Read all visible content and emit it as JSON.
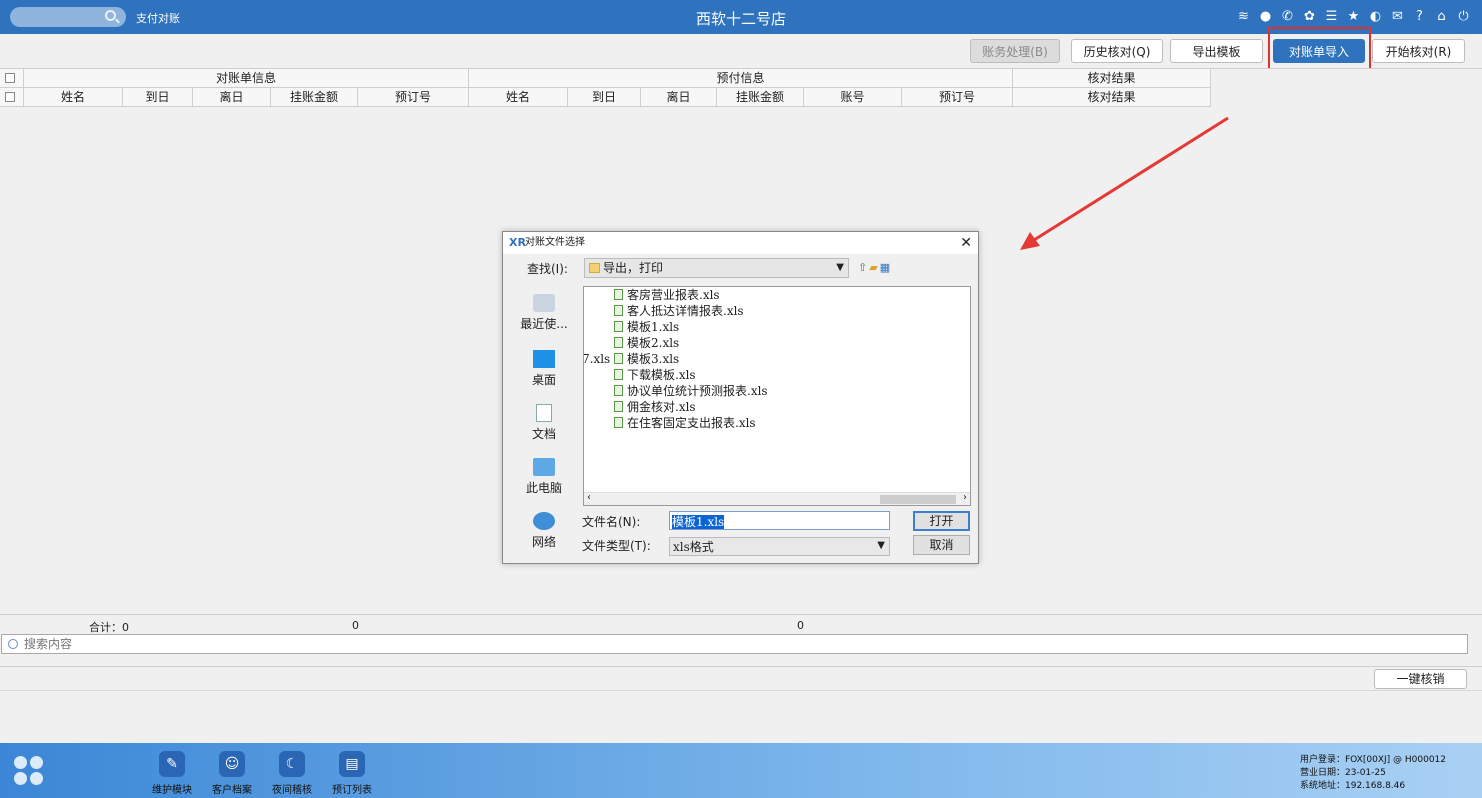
{
  "window": {
    "title": "西软十二号店",
    "module": "支付对账"
  },
  "toolbar": {
    "btn_accounting": "账务处理(B)",
    "btn_history": "历史核对(Q)",
    "btn_export_template": "导出模板",
    "btn_import": "对账单导入",
    "btn_start": "开始核对(R)"
  },
  "grid": {
    "group_headers": [
      "对账单信息",
      "预付信息",
      "核对结果"
    ],
    "columns": [
      "姓名",
      "到日",
      "离日",
      "挂账金额",
      "预订号",
      "姓名",
      "到日",
      "离日",
      "挂账金额",
      "账号",
      "预订号",
      "核对结果"
    ]
  },
  "summary": {
    "label": "合计：0",
    "value1": "0",
    "value2": "0"
  },
  "search": {
    "placeholder": "搜索内容"
  },
  "actions": {
    "one_click": "一键核销"
  },
  "dock": [
    "维护模块",
    "客户档案",
    "夜间稽核",
    "预订列表"
  ],
  "sysinfo": {
    "user": "用户登录：FOX[00XJ] @ H000012",
    "date": "营业日期：23-01-25",
    "addr": "系统地址：192.168.8.46"
  },
  "dialog": {
    "title": "对账文件选择",
    "lookin_label": "查找(I):",
    "lookin_value": "导出，打印",
    "places": [
      "最近使...",
      "桌面",
      "文档",
      "此电脑",
      "网络"
    ],
    "files": [
      "客房营业报表.xls",
      "客人抵达详情报表.xls",
      "模板1.xls",
      "模板2.xls",
      "模板3.xls",
      "下载模板.xls",
      "协议单位统计预测报表.xls",
      "佣金核对.xls",
      "在住客固定支出报表.xls"
    ],
    "clipped_file": "7.xls",
    "filename_label": "文件名(N):",
    "filename_value": "模板1.xls",
    "filetype_label": "文件类型(T):",
    "filetype_value": "xls格式",
    "open_button": "打开",
    "cancel_button": "取消"
  },
  "colors": {
    "titlebar": "#2f72bd",
    "highlight": "#e03030",
    "primary_button": "#2f72bd"
  }
}
